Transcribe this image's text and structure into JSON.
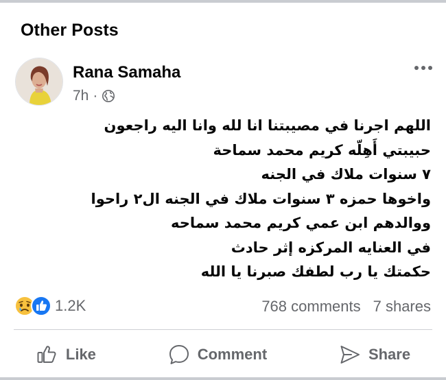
{
  "section_title": "Other Posts",
  "post": {
    "author": "Rana Samaha",
    "time": "7h",
    "separator": "·",
    "privacy_icon": "globe-icon",
    "more_icon": "more-options-icon",
    "lines": [
      "اللهم اجرنا في مصيبتنا انا لله وانا اليه راجعون",
      "حبيبتي أَهِلّه كريم محمد سماحة",
      "٧ سنوات ملاك في الجنه",
      "واخوها حمزه ٣ سنوات ملاك في الجنه ال٢ راحوا",
      "ووالدهم ابن عمي كريم محمد سماحه",
      "في العنايه المركزه إثر حادث",
      "حكمتك يا رب لطفك صبرنا يا الله"
    ]
  },
  "reactions": {
    "icons": [
      "sad-reaction-icon",
      "like-reaction-icon"
    ],
    "count": "1.2K"
  },
  "stats": {
    "comments": "768 comments",
    "shares": "7 shares"
  },
  "actions": {
    "like": "Like",
    "comment": "Comment",
    "share": "Share"
  },
  "colors": {
    "secondary_text": "#65676b",
    "like_blue": "#1877f2",
    "sad_yellow": "#f7c13e",
    "divider": "#ced0d4"
  }
}
